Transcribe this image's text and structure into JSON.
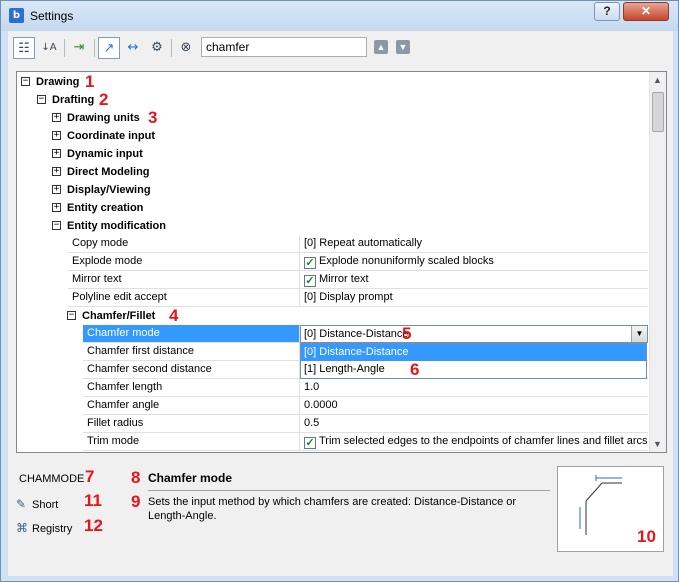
{
  "window": {
    "title": "Settings",
    "help_label": "?",
    "close_label": "✕"
  },
  "toolbar": {
    "search_value": "chamfer",
    "prev_label": "▲",
    "next_label": "▼"
  },
  "tree": {
    "nodes": [
      {
        "label": "Drawing",
        "expander": "−",
        "marker": "1"
      },
      {
        "label": "Drafting",
        "expander": "−",
        "marker": "2"
      },
      {
        "label": "Drawing units",
        "expander": "+",
        "marker": "3"
      },
      {
        "label": "Coordinate input",
        "expander": "+"
      },
      {
        "label": "Dynamic input",
        "expander": "+"
      },
      {
        "label": "Direct Modeling",
        "expander": "+"
      },
      {
        "label": "Display/Viewing",
        "expander": "+"
      },
      {
        "label": "Entity creation",
        "expander": "+"
      },
      {
        "label": "Entity modification",
        "expander": "−"
      }
    ],
    "entity_mod_props": [
      {
        "name": "Copy mode",
        "value": "[0] Repeat automatically"
      },
      {
        "name": "Explode mode",
        "value": "Explode nonuniformly scaled blocks",
        "checkbox": true
      },
      {
        "name": "Mirror text",
        "value": "Mirror text",
        "checkbox": true
      },
      {
        "name": "Polyline edit accept",
        "value": "[0] Display prompt"
      }
    ],
    "chamfer_node": {
      "label": "Chamfer/Fillet",
      "expander": "−",
      "marker": "4"
    },
    "chamfer_props": [
      {
        "name": "Chamfer mode",
        "value": "[0] Distance-Distance",
        "marker": "5"
      },
      {
        "name": "Chamfer first distance",
        "value": ""
      },
      {
        "name": "Chamfer second distance",
        "value": ""
      },
      {
        "name": "Chamfer length",
        "value": "1.0"
      },
      {
        "name": "Chamfer angle",
        "value": "0.0000"
      },
      {
        "name": "Fillet radius",
        "value": "0.5"
      },
      {
        "name": "Trim mode",
        "value": "Trim selected edges to the endpoints of chamfer lines and fillet arcs",
        "checkbox": true
      }
    ],
    "dropdown_options": [
      {
        "label": "[0] Distance-Distance",
        "selected": true
      },
      {
        "label": "[1] Length-Angle",
        "marker": "6"
      }
    ]
  },
  "description": {
    "variable": "CHAMMODE",
    "variable_marker": "7",
    "title": "Chamfer mode",
    "title_marker": "8",
    "text": "Sets the input method by which chamfers are created: Distance-Distance or Length-Angle.",
    "text_marker": "9",
    "short_label": "Short",
    "short_marker": "11",
    "registry_label": "Registry",
    "registry_marker": "12",
    "preview_marker": "10"
  },
  "colors": {
    "selection": "#3399ff",
    "marker": "#e8141a"
  }
}
